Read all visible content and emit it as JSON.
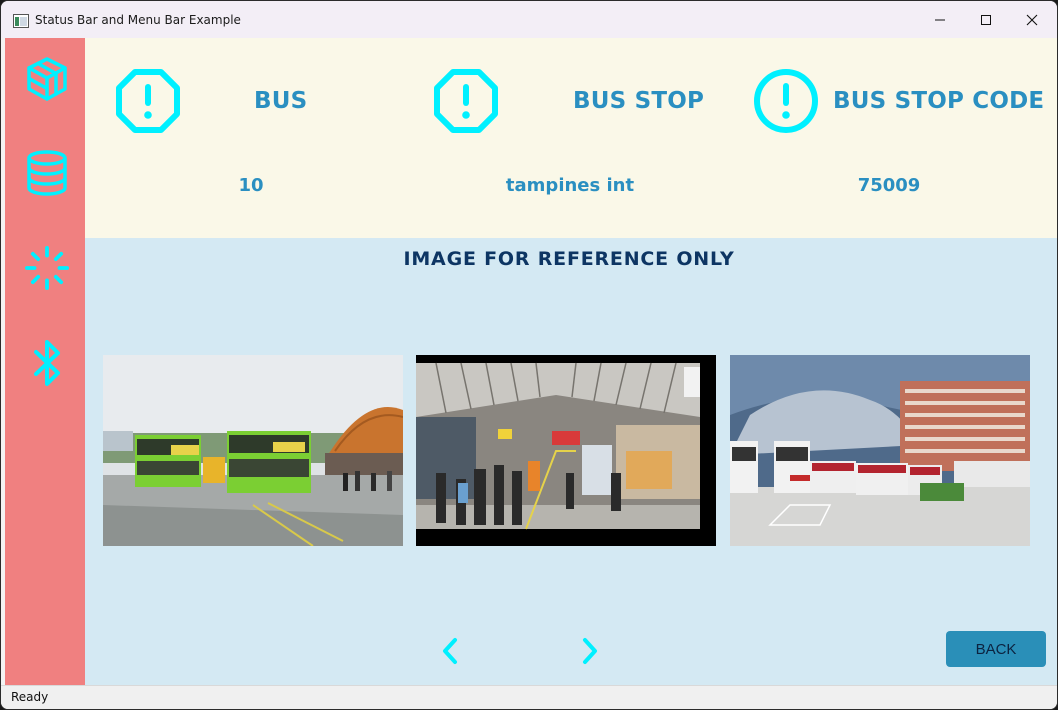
{
  "window": {
    "title": "Status Bar and Menu Bar Example",
    "icons": [
      "app-icon",
      "minimize-icon",
      "maximize-icon",
      "close-icon"
    ]
  },
  "sidebar": {
    "background": "#f08080",
    "icon_color": "#00f0ff",
    "items": [
      {
        "icon": "cube-icon"
      },
      {
        "icon": "database-icon"
      },
      {
        "icon": "loading-spinner-icon"
      },
      {
        "icon": "bluetooth-icon"
      }
    ]
  },
  "info": {
    "bus_label": "BUS",
    "bus_stop_label": "BUS STOP",
    "bus_stop_code_label": "BUS STOP CODE",
    "bus_value": "10",
    "bus_stop_value": "tampines int",
    "bus_stop_code_value": "75009",
    "accent_color": "#2a8fc1",
    "icons": [
      "octagon-alert-icon",
      "octagon-alert-icon",
      "circle-alert-icon"
    ]
  },
  "images": {
    "caption": "IMAGE FOR REFERENCE ONLY",
    "photos": [
      {
        "name": "bus-interchange-photo-1"
      },
      {
        "name": "bus-interchange-photo-2"
      },
      {
        "name": "bus-interchange-photo-3"
      }
    ],
    "prev_icon": "chevron-left-icon",
    "next_icon": "chevron-right-icon"
  },
  "buttons": {
    "back_label": "BACK"
  },
  "status": {
    "text": "Ready"
  }
}
